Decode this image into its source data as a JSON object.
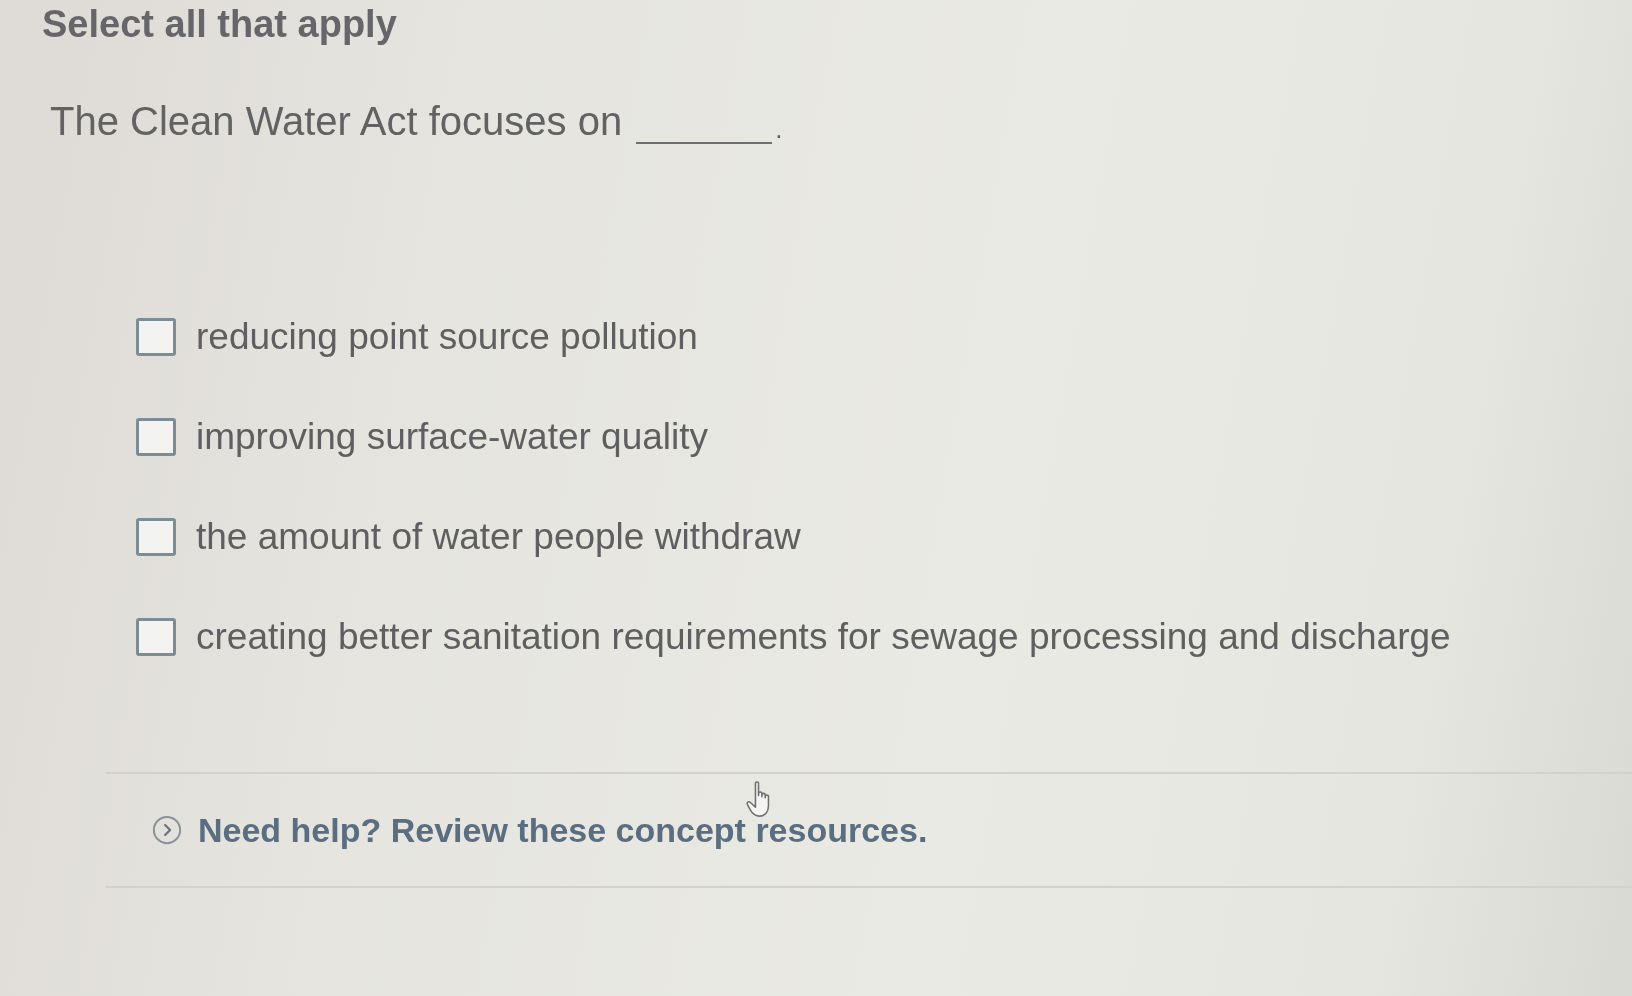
{
  "instruction": "Select all that apply",
  "question": {
    "text": "The Clean Water Act focuses on",
    "end_mark": "."
  },
  "options": [
    {
      "label": "reducing point source pollution",
      "checked": false
    },
    {
      "label": "improving surface-water quality",
      "checked": false
    },
    {
      "label": "the amount of water people withdraw",
      "checked": false
    },
    {
      "label": "creating better sanitation requirements for sewage processing and discharge",
      "checked": false
    }
  ],
  "help": {
    "text": "Need help? Review these concept resources.",
    "expanded": false
  }
}
